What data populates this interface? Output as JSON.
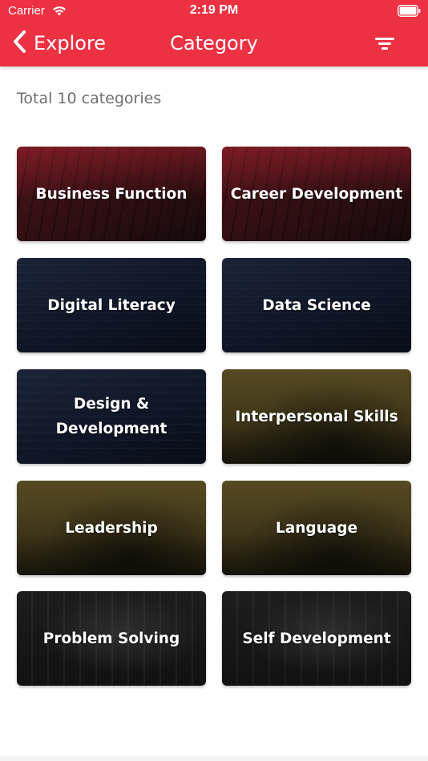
{
  "status_bar": {
    "carrier": "Carrier",
    "time": "2:19 PM"
  },
  "nav": {
    "back_label": "Explore",
    "title": "Category"
  },
  "summary": "Total 10 categories",
  "categories": [
    {
      "label": "Business Function",
      "theme": "red"
    },
    {
      "label": "Career Development",
      "theme": "red"
    },
    {
      "label": "Digital Literacy",
      "theme": "navy"
    },
    {
      "label": "Data Science",
      "theme": "navy"
    },
    {
      "label": "Design & Development",
      "theme": "navy"
    },
    {
      "label": "Interpersonal Skills",
      "theme": "olive"
    },
    {
      "label": "Leadership",
      "theme": "olive"
    },
    {
      "label": "Language",
      "theme": "olive"
    },
    {
      "label": "Problem Solving",
      "theme": "dark"
    },
    {
      "label": "Self Development",
      "theme": "dark"
    }
  ],
  "colors": {
    "header": "#ec3143",
    "summary_text": "#6f6f6f"
  },
  "icons": {
    "back": "chevron-left-icon",
    "filter": "filter-icon",
    "wifi": "wifi-icon",
    "battery": "battery-icon"
  }
}
